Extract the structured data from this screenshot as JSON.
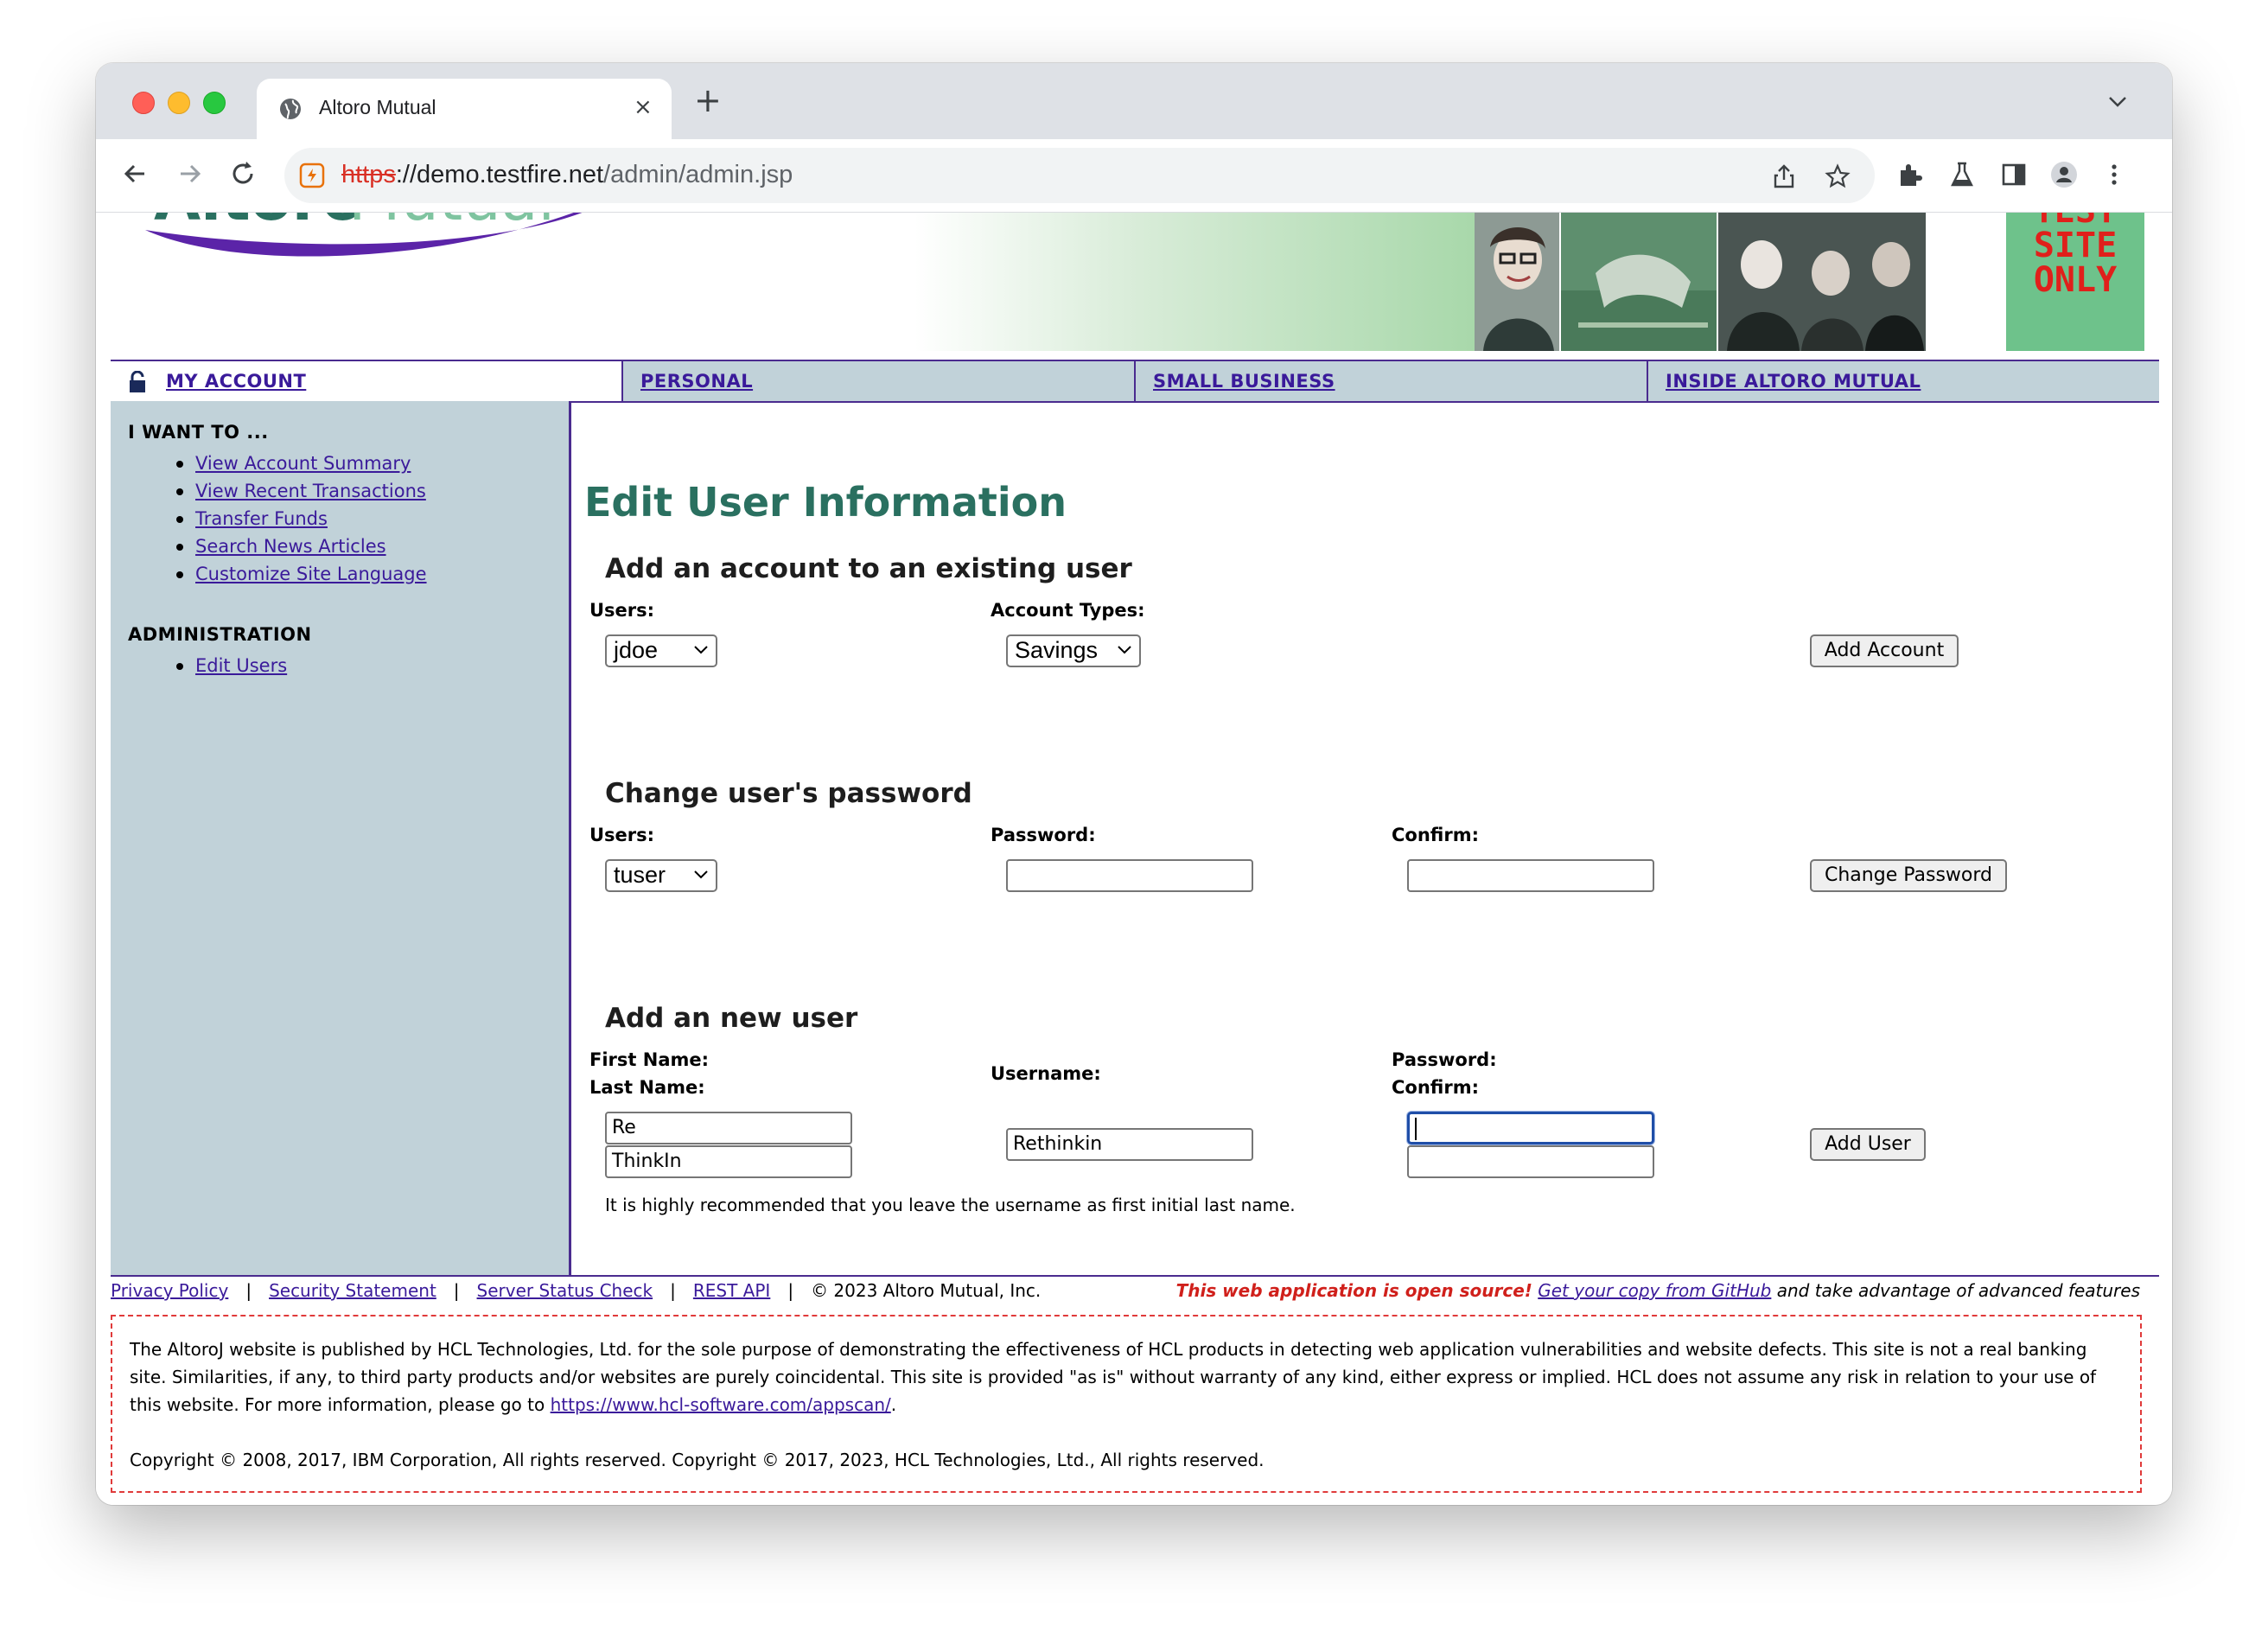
{
  "browser": {
    "tab_title": "Altoro Mutual",
    "tab_close": "×",
    "new_tab": "+",
    "url_scheme": "https",
    "url_rest": "://demo.testfire.net",
    "url_path": "/admin/admin.jsp"
  },
  "header": {
    "logo_text": "AltoroMutual",
    "test_banner_line1": "TEST",
    "test_banner_line2": "SITE",
    "test_banner_line3": "ONLY"
  },
  "nav": {
    "items": [
      {
        "label": "MY ACCOUNT"
      },
      {
        "label": "PERSONAL"
      },
      {
        "label": "SMALL BUSINESS"
      },
      {
        "label": "INSIDE ALTORO MUTUAL"
      }
    ]
  },
  "sidebar": {
    "heading1": "I WANT TO ...",
    "links1": [
      "View Account Summary",
      "View Recent Transactions",
      "Transfer Funds",
      "Search News Articles",
      "Customize Site Language"
    ],
    "heading2": "ADMINISTRATION",
    "links2": [
      "Edit Users"
    ]
  },
  "main": {
    "title": "Edit User Information",
    "add_account": {
      "heading": "Add an account to an existing user",
      "users_label": "Users:",
      "users_value": "jdoe",
      "types_label": "Account Types:",
      "types_value": "Savings",
      "button": "Add Account"
    },
    "change_password": {
      "heading": "Change user's password",
      "users_label": "Users:",
      "users_value": "tuser",
      "password_label": "Password:",
      "password_value": "",
      "confirm_label": "Confirm:",
      "confirm_value": "",
      "button": "Change Password"
    },
    "new_user": {
      "heading": "Add an new user",
      "first_name_label": "First Name:",
      "last_name_label": "Last Name:",
      "first_name_value": "Re",
      "last_name_value": "ThinkIn",
      "username_label": "Username:",
      "username_value": "Rethinkin",
      "password_label": "Password:",
      "confirm_label": "Confirm:",
      "password_value": "",
      "confirm_value": "",
      "button": "Add User",
      "hint": "It is highly recommended that you leave the username as first initial last name."
    }
  },
  "footer": {
    "links": [
      "Privacy Policy",
      "Security Statement",
      "Server Status Check",
      "REST API"
    ],
    "separator": "|",
    "copyright": "© 2023 Altoro Mutual, Inc.",
    "open_source": "This web application is open source!",
    "github_link": "Get your copy from GitHub",
    "tail": "and take advantage of advanced features"
  },
  "disclaimer": {
    "text": "The AltoroJ website is published by HCL Technologies, Ltd. for the sole purpose of demonstrating the effectiveness of HCL products in detecting web application vulnerabilities and website defects. This site is not a real banking site. Similarities, if any, to third party products and/or websites are purely coincidental. This site is provided \"as is\" without warranty of any kind, either express or implied. HCL does not assume any risk in relation to your use of this website. For more information, please go to",
    "link": "https://www.hcl-software.com/appscan/",
    "period": ".",
    "copyright": "Copyright © 2008, 2017, IBM Corporation, All rights reserved. Copyright © 2017, 2023, HCL Technologies, Ltd., All rights reserved."
  },
  "colors": {
    "nav_bg": "#c1d2d9",
    "nav_border": "#4a2b8f",
    "link": "#3a1a9a",
    "title": "#2a7060",
    "test_banner_bg": "#6ec28b",
    "test_banner_text": "#e0201b"
  }
}
